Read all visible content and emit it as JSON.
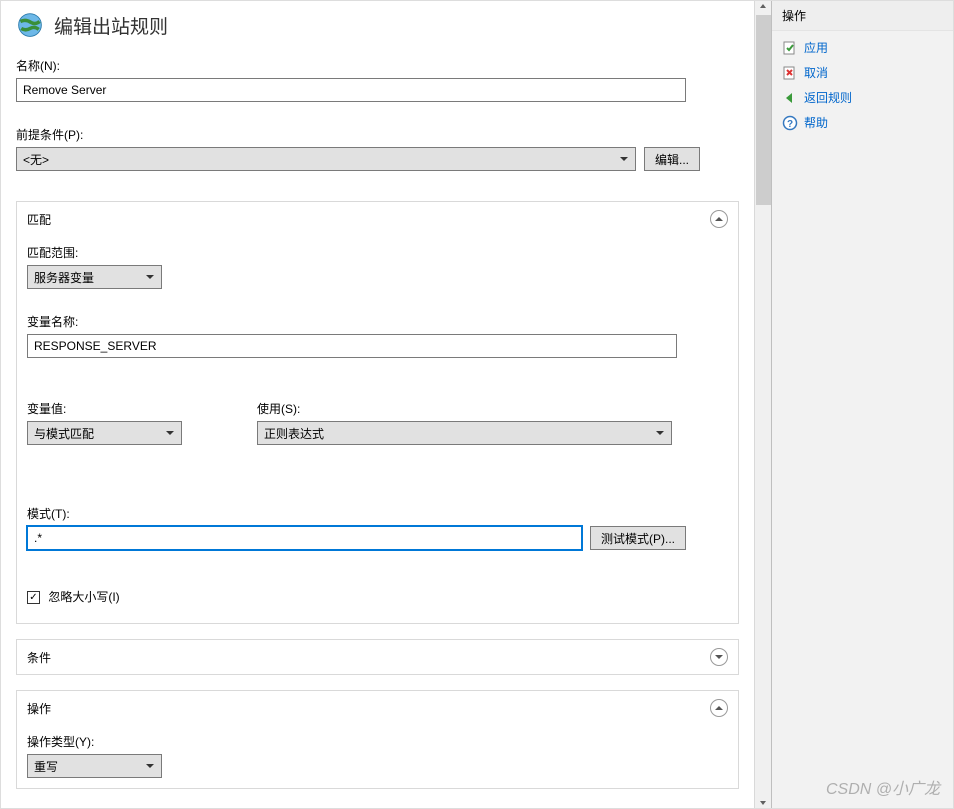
{
  "header": {
    "title": "编辑出站规则"
  },
  "fields": {
    "name_label": "名称(N):",
    "name_value": "Remove Server",
    "precondition_label": "前提条件(P):",
    "precondition_value": "<无>",
    "edit_button": "编辑..."
  },
  "match": {
    "title": "匹配",
    "scope_label": "匹配范围:",
    "scope_value": "服务器变量",
    "varname_label": "变量名称:",
    "varname_value": "RESPONSE_SERVER",
    "varvalue_label": "变量值:",
    "varvalue_value": "与模式匹配",
    "use_label": "使用(S):",
    "use_value": "正则表达式",
    "pattern_label": "模式(T):",
    "pattern_value": ".*",
    "test_button": "测试模式(P)...",
    "ignorecase_label": "忽略大小写(I)"
  },
  "conditions": {
    "title": "条件"
  },
  "action": {
    "title": "操作",
    "type_label": "操作类型(Y):",
    "type_value": "重写"
  },
  "actions_panel": {
    "header": "操作",
    "items": [
      {
        "label": "应用",
        "icon": "apply-icon"
      },
      {
        "label": "取消",
        "icon": "cancel-icon"
      },
      {
        "label": "返回规则",
        "icon": "back-icon"
      },
      {
        "label": "帮助",
        "icon": "help-icon"
      }
    ]
  },
  "watermark": "CSDN @小广龙"
}
